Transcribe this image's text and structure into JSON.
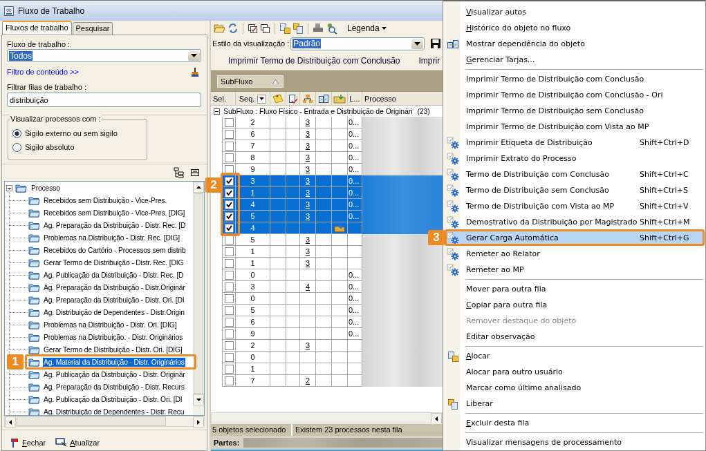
{
  "window": {
    "title": "Fluxo de Trabalho"
  },
  "left_panel": {
    "tabs": [
      {
        "label": "Fluxos de trabalho",
        "selected": true
      },
      {
        "label": "Pesquisar",
        "selected": false
      }
    ],
    "workflow_label": "Fluxo de trabalho :",
    "workflow_select": {
      "value": "Todos"
    },
    "content_filter_link": "Filtro de conteúdo >>",
    "queue_filter_label": "Filtrar filas de trabalho :",
    "queue_filter": {
      "value": "distribuição"
    },
    "visibility_group": {
      "title": "Visualizar processos com :",
      "options": [
        {
          "label": "Sigilo externo ou sem sigilo",
          "selected": true
        },
        {
          "label": "Sigilo absoluto",
          "selected": false
        }
      ]
    },
    "tree": {
      "label": "Processo",
      "expanded": true,
      "children": [
        {
          "label": "Recebidos sem Distribuição - Vice-Pres.",
          "selected": false
        },
        {
          "label": "Recebidos sem Distribuição - Vice-Pres. [DIG]",
          "selected": false
        },
        {
          "label": "Ag. Preparação da Distribuição - Distr. Rec. [D",
          "selected": false
        },
        {
          "label": "Problemas na Distribuição - Distr. Rec. [DIG]",
          "selected": false
        },
        {
          "label": "Recebidos do Cartório - Processos sem distrib",
          "selected": false
        },
        {
          "label": "Gerar Termo de Distribuição - Distr. Rec. [DIG",
          "selected": false
        },
        {
          "label": "Ag. Publicação da Distribuição - Distr. Rec. [D",
          "selected": false
        },
        {
          "label": "Ag. Preparação da Distribuição - Distr.Originár",
          "selected": false
        },
        {
          "label": "Ag. Preparação da Distribuição - Distr. Ori. [DI",
          "selected": false
        },
        {
          "label": "Ag. Distribuição de Dependentes - Distr.Origin",
          "selected": false
        },
        {
          "label": "Problemas na Distribuição - Distr. Ori. [DIG]",
          "selected": false
        },
        {
          "label": "Problemas na Distribuição. - Distr. Originários",
          "selected": false
        },
        {
          "label": "Gerar Termo de Distribuição - Distr. Ori. [DIG]",
          "selected": false
        },
        {
          "label": "Ag. Material da Distribuição - Distr. Originários",
          "selected": true
        },
        {
          "label": "Ag. Publicação da Distribuição - Distr. Originár",
          "selected": false
        },
        {
          "label": "Ag. Preparação da Distribuição - Distr. Recurs",
          "selected": false
        },
        {
          "label": "Ag. Publicação da Distribuição - Distr. Ori. [DI",
          "selected": false
        },
        {
          "label": "Ag. Distribuição de Dependentes - Distr. Recu",
          "selected": false
        }
      ]
    },
    "footer_buttons": [
      {
        "label": "Fechar",
        "mnemonic": true
      },
      {
        "label": "Atualizar",
        "mnemonic": true
      }
    ]
  },
  "toolbar": {
    "legend_button": "Legenda"
  },
  "view_style": {
    "label": "Estilo da visualização :",
    "value": "Padrão"
  },
  "actions": [
    "Imprimir Termo de Distribuição com Conclusão",
    "Imprir"
  ],
  "group_by": {
    "chip": "SubFluxo"
  },
  "table": {
    "columns": [
      {
        "kind": "text",
        "label": "Sel."
      },
      {
        "kind": "dropdown",
        "label": "Seq."
      },
      {
        "kind": "icon"
      },
      {
        "kind": "icon"
      },
      {
        "kind": "icon"
      },
      {
        "kind": "icon"
      },
      {
        "kind": "icon"
      },
      {
        "kind": "text",
        "label": "L..."
      },
      {
        "kind": "text",
        "label": "Processo"
      }
    ],
    "group_row": {
      "label": "SubFluxo : Fluxo Físico - Entrada e Distribuição de Originári",
      "count": "(23)",
      "expanded": true
    },
    "rows": [
      {
        "checked": false,
        "selected": false,
        "seq": "2",
        "col_5": "3",
        "folder_icon": false,
        "col_8": "0..."
      },
      {
        "checked": false,
        "selected": false,
        "seq": "6",
        "col_5": "3",
        "folder_icon": false,
        "col_8": "0..."
      },
      {
        "checked": false,
        "selected": false,
        "seq": "7",
        "col_5": "3",
        "folder_icon": false,
        "col_8": "0..."
      },
      {
        "checked": false,
        "selected": false,
        "seq": "8",
        "col_5": "3",
        "folder_icon": false,
        "col_8": "0..."
      },
      {
        "checked": false,
        "selected": false,
        "seq": "9",
        "col_5": "3",
        "folder_icon": false,
        "col_8": "0..."
      },
      {
        "checked": true,
        "selected": true,
        "seq": "3",
        "col_5": "3",
        "folder_icon": false,
        "col_8": "0..."
      },
      {
        "checked": true,
        "selected": true,
        "seq": "1",
        "col_5": "3",
        "folder_icon": false,
        "col_8": "0..."
      },
      {
        "checked": true,
        "selected": true,
        "seq": "4",
        "col_5": "3",
        "folder_icon": false,
        "col_8": "0..."
      },
      {
        "checked": true,
        "selected": true,
        "seq": "5",
        "col_5": "3",
        "folder_icon": false,
        "col_8": "0..."
      },
      {
        "checked": true,
        "selected": true,
        "seq": "4",
        "folder_icon": true
      },
      {
        "checked": false,
        "selected": false,
        "seq": "5",
        "col_5": "3",
        "folder_icon": false
      },
      {
        "checked": false,
        "selected": false,
        "seq": "1",
        "col_5": "3",
        "folder_icon": false
      },
      {
        "checked": false,
        "selected": false,
        "seq": "1",
        "col_5": "3",
        "folder_icon": false
      },
      {
        "checked": false,
        "selected": false,
        "seq": "0",
        "folder_icon": false,
        "col_8": "0..."
      },
      {
        "checked": false,
        "selected": false,
        "seq": "3",
        "col_5": "4",
        "folder_icon": false,
        "col_8": "0..."
      },
      {
        "checked": false,
        "selected": false,
        "seq": "0",
        "folder_icon": false,
        "col_8": "0..."
      },
      {
        "checked": false,
        "selected": false,
        "seq": "5",
        "folder_icon": false,
        "col_8": "0..."
      },
      {
        "checked": false,
        "selected": false,
        "seq": "6",
        "folder_icon": false,
        "col_8": "0..."
      },
      {
        "checked": false,
        "selected": false,
        "seq": "9",
        "folder_icon": false,
        "col_8": "0..."
      },
      {
        "checked": false,
        "selected": false,
        "seq": "2",
        "col_5": "3",
        "folder_icon": false
      },
      {
        "checked": false,
        "selected": false,
        "seq": "0",
        "folder_icon": false
      },
      {
        "checked": false,
        "selected": false,
        "seq": "1",
        "folder_icon": false
      },
      {
        "checked": false,
        "selected": false,
        "seq": "7",
        "col_5": "2",
        "folder_icon": false
      }
    ]
  },
  "status_bar": {
    "selection": "5 objetos selecionado",
    "total": "Existem 23 processos nesta fila"
  },
  "parties": {
    "label": "Partes:"
  },
  "context_menu": [
    {
      "kind": "plain",
      "label": "Visualizar autos",
      "mnemonic": true,
      "disabled": false,
      "selected": false
    },
    {
      "kind": "plain",
      "label": "Histórico do objeto no fluxo",
      "mnemonic": true,
      "disabled": false,
      "selected": false
    },
    {
      "kind": "dependency",
      "label": "Mostrar dependência do objeto",
      "mnemonic": false,
      "disabled": false,
      "selected": false
    },
    {
      "kind": "plain",
      "label": "Gerenciar Tarjas...",
      "mnemonic": true,
      "disabled": false,
      "selected": false
    },
    {
      "kind": "separator"
    },
    {
      "kind": "plain",
      "label": "Imprimir Termo de Distribuição com Conclusão",
      "mnemonic": false,
      "disabled": false,
      "selected": false
    },
    {
      "kind": "plain",
      "label": "Imprimir Termo de Distribuição com Conclusão - Ori",
      "mnemonic": false,
      "disabled": false,
      "selected": false
    },
    {
      "kind": "plain",
      "label": "Imprimir Termo de Distribuição sem Conclusão",
      "mnemonic": false,
      "disabled": false,
      "selected": false
    },
    {
      "kind": "plain",
      "label": "Imprimir Termo de Distribuição com Vista ao MP",
      "mnemonic": false,
      "disabled": false,
      "selected": false
    },
    {
      "kind": "automated",
      "label": "Imprimir Etiqueta de Distribuição",
      "shortcut": "Shift+Ctrl+D",
      "mnemonic": false,
      "disabled": false,
      "selected": false
    },
    {
      "kind": "automated",
      "label": "Imprimir Extrato do Processo",
      "mnemonic": false,
      "disabled": false,
      "selected": false
    },
    {
      "kind": "automated",
      "label": "Termo de Distribuição com Conclusão",
      "shortcut": "Shift+Ctrl+C",
      "mnemonic": false,
      "disabled": false,
      "selected": false
    },
    {
      "kind": "automated",
      "label": "Termo de Distribuição sem Conclusão",
      "shortcut": "Shift+Ctrl+S",
      "mnemonic": false,
      "disabled": false,
      "selected": false
    },
    {
      "kind": "automated",
      "label": "Termo de Distribuição com Vista ao MP",
      "shortcut": "Shift+Ctrl+V",
      "mnemonic": false,
      "disabled": false,
      "selected": false
    },
    {
      "kind": "automated",
      "label": "Demostrativo da Distribuição por Magistrado",
      "shortcut": "Shift+Ctrl+M",
      "mnemonic": false,
      "disabled": false,
      "selected": false
    },
    {
      "kind": "automated",
      "label": "Gerar Carga Automática",
      "shortcut": "Shift+Ctrl+G",
      "mnemonic": false,
      "disabled": false,
      "selected": true
    },
    {
      "kind": "automated",
      "label": "Remeter ao Relator",
      "mnemonic": false,
      "disabled": false,
      "selected": false
    },
    {
      "kind": "automated",
      "label": "Remeter ao MP",
      "mnemonic": false,
      "disabled": false,
      "selected": false
    },
    {
      "kind": "separator"
    },
    {
      "kind": "plain",
      "label": "Mover para outra fila",
      "mnemonic": false,
      "disabled": false,
      "selected": false
    },
    {
      "kind": "plain",
      "label": "Copiar para outra fila",
      "mnemonic": true,
      "disabled": false,
      "selected": false
    },
    {
      "kind": "plain",
      "label": "Remover destaque do objeto",
      "mnemonic": false,
      "disabled": true,
      "selected": false
    },
    {
      "kind": "plain",
      "label": "Editar observação",
      "mnemonic": false,
      "disabled": false,
      "selected": false
    },
    {
      "kind": "separator"
    },
    {
      "kind": "allocate",
      "label": "Alocar",
      "mnemonic": true,
      "disabled": false,
      "selected": false
    },
    {
      "kind": "plain",
      "label": "Alocar para outro usuário",
      "mnemonic": false,
      "disabled": false,
      "selected": false
    },
    {
      "kind": "plain",
      "label": "Marcar como último analisado",
      "mnemonic": false,
      "disabled": false,
      "selected": false
    },
    {
      "kind": "release",
      "label": "Liberar",
      "mnemonic": false,
      "disabled": false,
      "selected": false
    },
    {
      "kind": "separator"
    },
    {
      "kind": "plain",
      "label": "Excluir desta fila",
      "mnemonic": true,
      "disabled": false,
      "selected": false
    },
    {
      "kind": "separator"
    },
    {
      "kind": "plain",
      "label": "Visualizar mensagens de processamento",
      "mnemonic": false,
      "disabled": false,
      "selected": false
    }
  ],
  "annotations": [
    {
      "label": "1"
    },
    {
      "label": "2"
    },
    {
      "label": "3"
    }
  ]
}
